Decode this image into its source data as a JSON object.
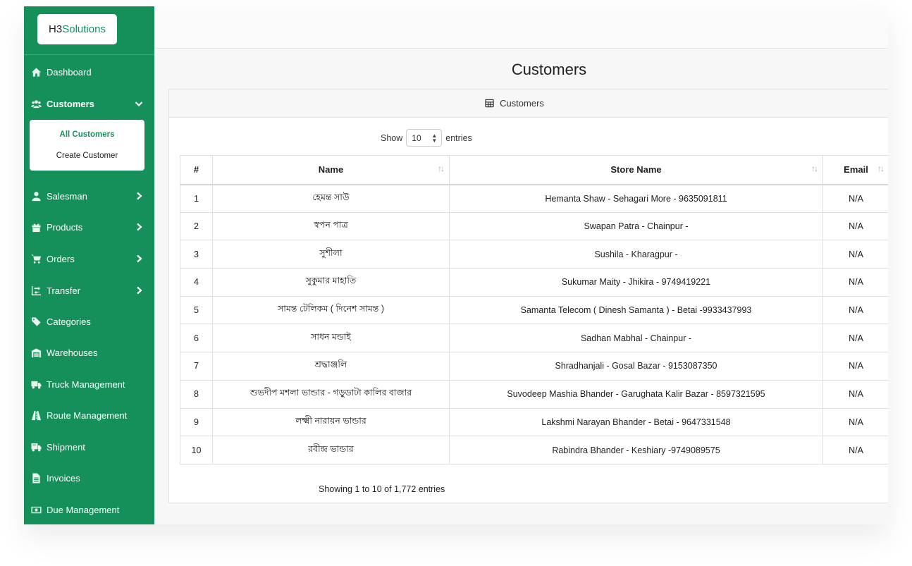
{
  "logo": {
    "text_prefix": "H3 ",
    "text_accent": "Solutions"
  },
  "sidebar": {
    "items": [
      {
        "label": "Dashboard",
        "icon": "home-icon",
        "chevron": "none"
      },
      {
        "label": "Customers",
        "icon": "users-icon",
        "chevron": "down"
      },
      {
        "label": "Salesman",
        "icon": "user-icon",
        "chevron": "right"
      },
      {
        "label": "Products",
        "icon": "gift-icon",
        "chevron": "right"
      },
      {
        "label": "Orders",
        "icon": "cart-icon",
        "chevron": "right"
      },
      {
        "label": "Transfer",
        "icon": "transfer-icon",
        "chevron": "right"
      },
      {
        "label": "Categories",
        "icon": "tags-icon",
        "chevron": "none"
      },
      {
        "label": "Warehouses",
        "icon": "warehouse-icon",
        "chevron": "none"
      },
      {
        "label": "Truck Management",
        "icon": "truck-icon",
        "chevron": "none"
      },
      {
        "label": "Route Management",
        "icon": "route-icon",
        "chevron": "none"
      },
      {
        "label": "Shipment",
        "icon": "shipping-icon",
        "chevron": "none"
      },
      {
        "label": "Invoices",
        "icon": "file-icon",
        "chevron": "none"
      },
      {
        "label": "Due Management",
        "icon": "money-icon",
        "chevron": "none"
      }
    ],
    "submenu": [
      {
        "label": "All Customers",
        "active": true
      },
      {
        "label": "Create Customer",
        "active": false
      }
    ]
  },
  "page": {
    "title": "Customers"
  },
  "card": {
    "header": "Customers",
    "show_label": "Show",
    "entries_label": "entries",
    "page_length": "10",
    "info": "Showing 1 to 10 of 1,772 entries"
  },
  "table": {
    "columns": [
      "#",
      "Name",
      "Store Name",
      "Email"
    ],
    "rows": [
      [
        "1",
        "হেমন্ত সাউ",
        "Hemanta Shaw - Sehagari More - 9635091811",
        "N/A"
      ],
      [
        "2",
        "স্বপন পাত্র",
        "Swapan Patra - Chainpur -",
        "N/A"
      ],
      [
        "3",
        "সুশীলা",
        "Sushila - Kharagpur -",
        "N/A"
      ],
      [
        "4",
        "সুকুমার মাহাতি",
        "Sukumar Maity - Jhikira - 9749419221",
        "N/A"
      ],
      [
        "5",
        "সামন্ত টেলিকম ( দিনেশ সামন্ত )",
        "Samanta Telecom ( Dinesh Samanta ) - Betai -9933437993",
        "N/A"
      ],
      [
        "6",
        "সাধন মন্ডাই",
        "Sadhan Mabhal - Chainpur -",
        "N/A"
      ],
      [
        "7",
        "শ্রদ্ধাঞ্জলি",
        "Shradhanjali - Gosal Bazar - 9153087350",
        "N/A"
      ],
      [
        "8",
        "শুভদীপ মশলা ভান্ডার - গড়ুডাটা কালির বাজার",
        "Suvodeep Mashia Bhander - Garughata Kalir Bazar - 8597321595",
        "N/A"
      ],
      [
        "9",
        "লক্ষ্মী নারায়ন ভান্ডার",
        "Lakshmi Narayan Bhander - Betai - 9647331548",
        "N/A"
      ],
      [
        "10",
        "রবীন্দ্র ভান্ডার",
        "Rabindra Bhander - Keshiary -9749089575",
        "N/A"
      ]
    ]
  },
  "colors": {
    "sidebar_bg": "#15905a",
    "accent": "#15905a"
  }
}
